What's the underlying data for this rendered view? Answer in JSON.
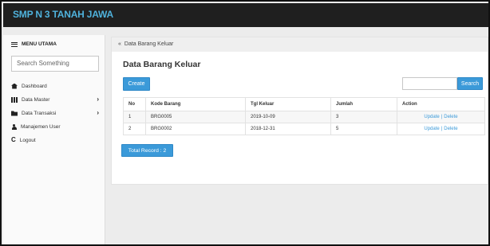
{
  "app": {
    "title": "SMP N 3 TANAH JAWA"
  },
  "sidebar": {
    "menu_title": "MENU UTAMA",
    "search_placeholder": "Search Something",
    "items": [
      {
        "label": "Dashboard",
        "icon": "home-icon",
        "submenu": false
      },
      {
        "label": "Data Master",
        "icon": "grid-icon",
        "submenu": true
      },
      {
        "label": "Data Transaksi",
        "icon": "folder-icon",
        "submenu": true
      },
      {
        "label": "Manajemen User",
        "icon": "user-icon",
        "submenu": false
      },
      {
        "label": "Logout",
        "icon": "logout-icon",
        "submenu": false
      }
    ]
  },
  "breadcrumb": {
    "back_glyph": "«",
    "label": "Data Barang Keluar"
  },
  "main": {
    "title": "Data Barang Keluar",
    "create_label": "Create",
    "search_label": "Search",
    "table": {
      "headers": [
        "No",
        "Kode Barang",
        "Tgl Keluar",
        "Jumlah",
        "Action"
      ],
      "rows": [
        {
          "no": "1",
          "kode": "BRG0005",
          "tgl": "2019-10-09",
          "jumlah": "3",
          "update": "Update",
          "sep": "|",
          "delete": "Delete"
        },
        {
          "no": "2",
          "kode": "BRG0002",
          "tgl": "2018-12-31",
          "jumlah": "5",
          "update": "Update",
          "sep": "|",
          "delete": "Delete"
        }
      ]
    },
    "total_label": "Total Record : 2"
  },
  "colors": {
    "topbar": "#1f1f1f",
    "brand": "#4fb2dc",
    "accent": "#3b9ad9"
  }
}
